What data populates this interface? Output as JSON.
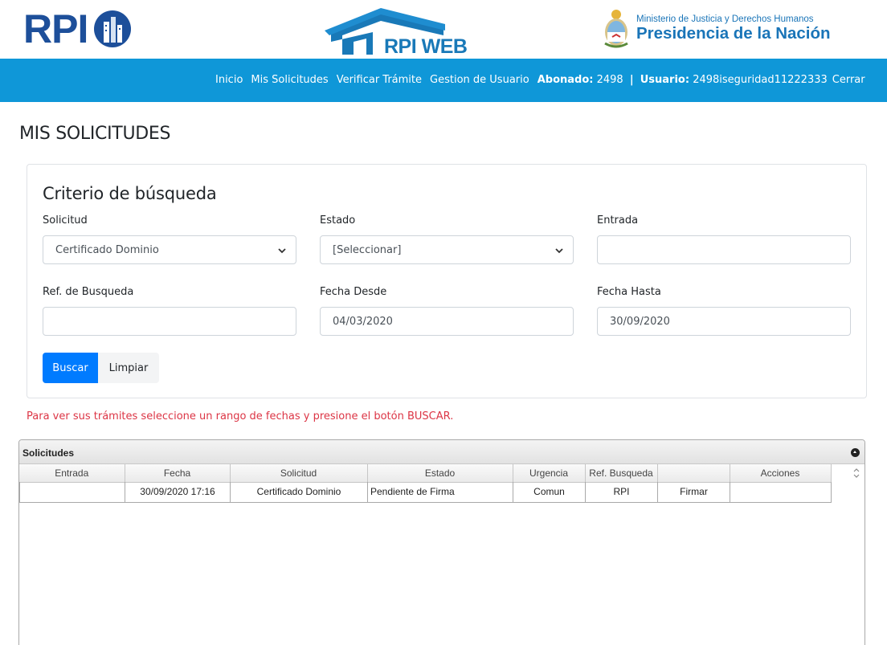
{
  "header": {
    "logo_left": "RPI",
    "logo_center": "RPI WEB",
    "ministry": "Ministerio de Justicia y Derechos Humanos",
    "presidency": "Presidencia de la Nación"
  },
  "nav": {
    "items": [
      "Inicio",
      "Mis Solicitudes",
      "Verificar Trámite",
      "Gestion de Usuario"
    ],
    "abonado_label": "Abonado:",
    "abonado_value": "2498",
    "separator": "|",
    "usuario_label": "Usuario:",
    "usuario_value": "2498iseguridad11222333",
    "logout": "Cerrar"
  },
  "page_title": "MIS SOLICITUDES",
  "search": {
    "title": "Criterio de búsqueda",
    "solicitud_label": "Solicitud",
    "solicitud_value": "Certificado Dominio",
    "estado_label": "Estado",
    "estado_value": "[Seleccionar]",
    "entrada_label": "Entrada",
    "entrada_value": "",
    "ref_label": "Ref. de Busqueda",
    "ref_value": "",
    "desde_label": "Fecha Desde",
    "desde_value": "04/03/2020",
    "hasta_label": "Fecha Hasta",
    "hasta_value": "30/09/2020",
    "buscar": "Buscar",
    "limpiar": "Limpiar"
  },
  "hint": "Para ver sus trámites seleccione un rango de fechas y presione el botón BUSCAR.",
  "grid": {
    "caption": "Solicitudes",
    "columns": [
      "Entrada",
      "Fecha",
      "Solicitud",
      "Estado",
      "Urgencia",
      "Ref. Busqueda",
      "",
      "Acciones"
    ],
    "rows": [
      [
        "",
        "30/09/2020 17:16",
        "Certificado Dominio",
        "Pendiente de Firma",
        "Comun",
        "RPI",
        "Firmar",
        ""
      ]
    ]
  },
  "colors": {
    "nav_bg": "#0f97d8",
    "primary": "#007bff",
    "hint": "#dc3545",
    "brand": "#1d4f9a"
  }
}
